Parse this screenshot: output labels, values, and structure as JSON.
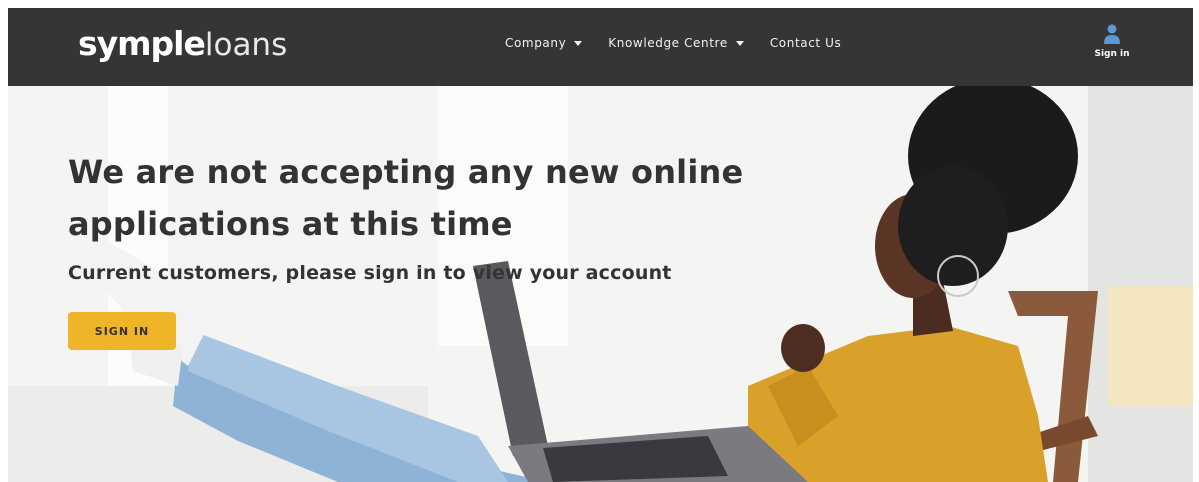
{
  "header": {
    "logo_bold": "symple",
    "logo_light": "loans",
    "nav": [
      {
        "label": "Company"
      },
      {
        "label": "Knowledge Centre"
      },
      {
        "label": "Contact Us"
      }
    ],
    "signin_label": "Sign in",
    "user_icon": "user-icon"
  },
  "hero": {
    "headline_line1": "We are not accepting any new online",
    "headline_line2": "applications at this time",
    "subheadline": "Current customers, please sign in to view your account",
    "cta_label": "SIGN IN"
  },
  "colors": {
    "header_bg": "#353535",
    "accent": "#f0b429",
    "text_dark": "#333333"
  }
}
